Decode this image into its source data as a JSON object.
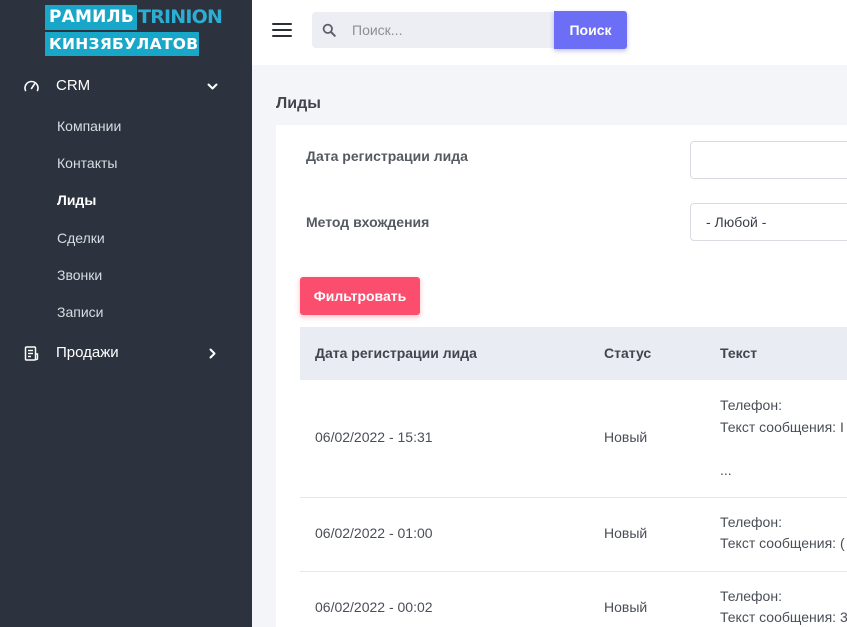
{
  "sidebar": {
    "logo": {
      "line1_a": "РАМИЛЬ",
      "line1_b": "TRINION",
      "line2": "КИНЗЯБУЛАТОВ"
    },
    "groups": [
      {
        "label": "CRM",
        "icon": "speedometer-icon",
        "expanded": true
      },
      {
        "label": "Продажи",
        "icon": "receipt-icon",
        "expanded": false
      }
    ],
    "items": [
      {
        "label": "Компании"
      },
      {
        "label": "Контакты"
      },
      {
        "label": "Лиды",
        "active": true
      },
      {
        "label": "Сделки"
      },
      {
        "label": "Звонки"
      },
      {
        "label": "Записи"
      }
    ]
  },
  "topbar": {
    "search_placeholder": "Поиск...",
    "search_button": "Поиск"
  },
  "page": {
    "title": "Лиды",
    "filters": {
      "date_label": "Дата регистрации лида",
      "date_value": "",
      "method_label": "Метод вхождения",
      "method_value": "- Любой -",
      "filter_button": "Фильтровать"
    },
    "table": {
      "columns": [
        "Дата регистрации лида",
        "Статус",
        "Текст"
      ],
      "rows": [
        {
          "date": "06/02/2022 - 15:31",
          "status": "Новый",
          "text_line1": "Телефон:",
          "text_line2": "Текст сообщения: I",
          "text_line3": "..."
        },
        {
          "date": "06/02/2022 - 01:00",
          "status": "Новый",
          "text_line1": "Телефон:",
          "text_line2": "Текст сообщения: (",
          "text_line3": ""
        },
        {
          "date": "06/02/2022 - 00:02",
          "status": "Новый",
          "text_line1": "Телефон:",
          "text_line2": "Текст сообщения: 3",
          "text_line3": ""
        }
      ]
    }
  },
  "colors": {
    "sidebar_bg": "#2c333e",
    "logo_blue": "#19a7c9",
    "search_button": "#6c6ff5",
    "filter_button": "#fb4d6d",
    "table_header_bg": "#e9ecf2"
  }
}
